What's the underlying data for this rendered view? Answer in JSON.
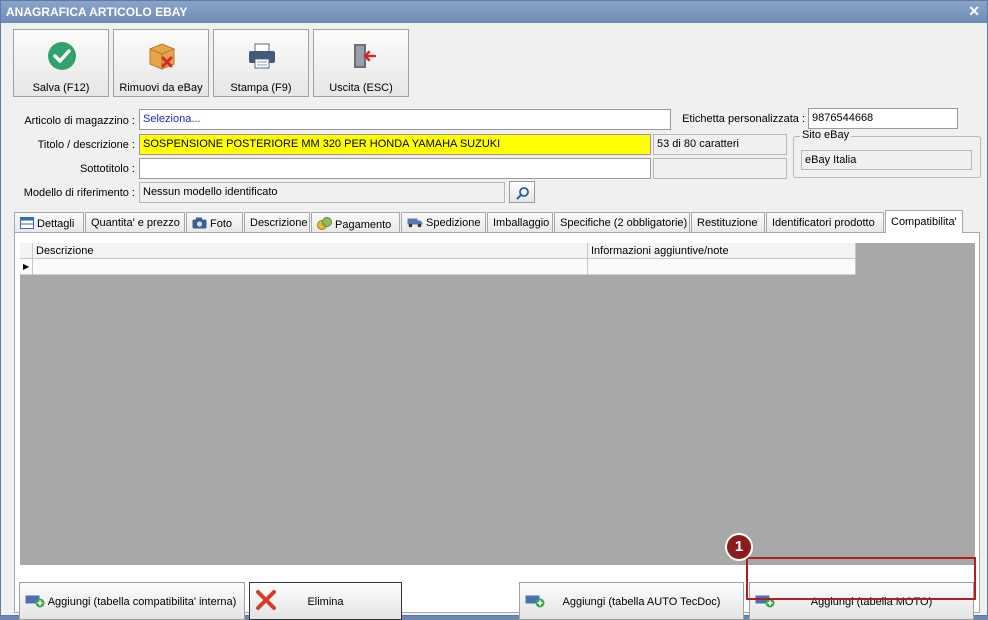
{
  "window": {
    "title": "ANAGRAFICA ARTICOLO EBAY",
    "close_icon": "✕"
  },
  "toolbar": {
    "save": "Salva (F12)",
    "remove": "Rimuovi da eBay",
    "print": "Stampa (F9)",
    "exit": "Uscita (ESC)"
  },
  "form": {
    "article_label": "Articolo di magazzino :",
    "article_value": "Seleziona...",
    "custom_label_label": "Etichetta personalizzata :",
    "custom_label_value": "9876544668",
    "title_label": "Titolo / descrizione :",
    "title_value": "SOSPENSIONE POSTERIORE MM 320 PER HONDA YAMAHA SUZUKI",
    "char_count": "53 di 80 caratteri",
    "subtitle_label": "Sottotitolo :",
    "subtitle_value": "",
    "model_label": "Modello di riferimento :",
    "model_value": "Nessun modello identificato",
    "site_group_title": "Sito eBay",
    "site_value": "eBay Italia"
  },
  "tabs": [
    {
      "label": "Dettagli"
    },
    {
      "label": "Quantita' e prezzo"
    },
    {
      "label": "Foto"
    },
    {
      "label": "Descrizione"
    },
    {
      "label": "Pagamento"
    },
    {
      "label": "Spedizione"
    },
    {
      "label": "Imballaggio"
    },
    {
      "label": "Specifiche (2 obbligatorie)"
    },
    {
      "label": "Restituzione"
    },
    {
      "label": "Identificatori prodotto"
    },
    {
      "label": "Compatibilita'"
    }
  ],
  "grid": {
    "columns": [
      "Descrizione",
      "Informazioni aggiuntive/note"
    ],
    "row_marker": "▶"
  },
  "bottom_buttons": {
    "add_internal": "Aggiungi (tabella compatibilita' interna)",
    "delete": "Elimina",
    "add_auto": "Aggiungi (tabella AUTO TecDoc)",
    "add_moto": "Aggiungi (tabella MOTO)"
  },
  "annotation": {
    "callout_number": "1"
  },
  "colors": {
    "titlebar": "#7a96c0",
    "highlight": "#b01e1e",
    "title_field": "#ffff00"
  }
}
